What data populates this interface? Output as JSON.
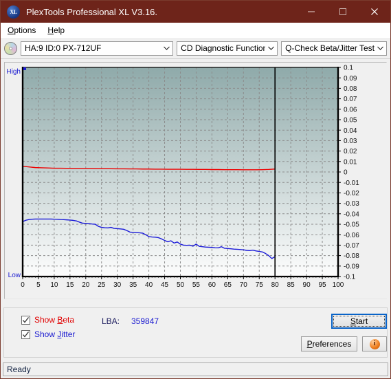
{
  "window": {
    "title": "PlexTools Professional XL V3.16.",
    "logo_text": "XL",
    "logo_icon": "xl-disc-logo",
    "minimize_icon": "minimize-icon",
    "maximize_icon": "maximize-icon",
    "close_icon": "close-icon"
  },
  "menu": {
    "items": [
      {
        "label": "Options",
        "accel": "O"
      },
      {
        "label": "Help",
        "accel": "H"
      }
    ]
  },
  "toolbar": {
    "disc_icon": "cd-disc-icon",
    "drive_combo": {
      "value": "HA:9 ID:0  PX-712UF",
      "arrow_icon": "chevron-down-icon"
    },
    "function_combo": {
      "value": "CD Diagnostic Functions",
      "arrow_icon": "chevron-down-icon"
    },
    "test_combo": {
      "value": "Q-Check Beta/Jitter Test",
      "arrow_icon": "chevron-down-icon"
    }
  },
  "controls": {
    "show_beta": {
      "label_pre": "Show ",
      "accel": "B",
      "label_post": "eta",
      "checked": true,
      "color": "#e00000"
    },
    "show_jitter": {
      "label_pre": "Show ",
      "accel": "J",
      "label_post": "itter",
      "checked": true,
      "color": "#1a1ad0"
    },
    "lba_label": "LBA:",
    "lba_value": "359847",
    "start_button": {
      "label_pre": "",
      "accel": "S",
      "label_post": "tart",
      "focused": true
    },
    "preferences_button": {
      "label_pre": "",
      "accel": "P",
      "label_post": "references"
    },
    "info_button": {
      "glyph": "i",
      "icon": "info-icon"
    }
  },
  "statusbar": {
    "text": "Ready"
  },
  "chart_data": {
    "type": "line",
    "title": "",
    "xlabel": "",
    "ylabel": "",
    "xlim": [
      0,
      100
    ],
    "ylim": [
      -0.1,
      0.1
    ],
    "xticks": [
      0,
      5,
      10,
      15,
      20,
      25,
      30,
      35,
      40,
      45,
      50,
      55,
      60,
      65,
      70,
      75,
      80,
      85,
      90,
      95,
      100
    ],
    "yticks": [
      0.1,
      0.09,
      0.08,
      0.07,
      0.06,
      0.05,
      0.04,
      0.03,
      0.02,
      0.01,
      0,
      -0.01,
      -0.02,
      -0.03,
      -0.04,
      -0.05,
      -0.06,
      -0.07,
      -0.08,
      -0.09,
      -0.1
    ],
    "ytick_labels": [
      "0.1",
      "0.09",
      "0.08",
      "0.07",
      "0.06",
      "0.05",
      "0.04",
      "0.03",
      "0.02",
      "0.01",
      "0",
      "-0.01",
      "-0.02",
      "-0.03",
      "-0.04",
      "-0.05",
      "-0.06",
      "-0.07",
      "-0.08",
      "-0.09",
      "-0.1"
    ],
    "grid": true,
    "grid_style": "dashed",
    "grid_color": "#8c8c8c",
    "axis_label_high": "High",
    "axis_label_low": "Low",
    "axis_label_color": "#1a1ad0",
    "data_end_marker_x": 80,
    "plot_bg_gradient": [
      "#8faaaa",
      "#fdfdfd"
    ],
    "legend_position": "none",
    "series": [
      {
        "name": "Beta",
        "color": "#ee0000",
        "x": [
          0,
          2,
          4,
          6,
          8,
          10,
          12,
          14,
          16,
          18,
          20,
          22,
          24,
          26,
          28,
          30,
          32,
          34,
          36,
          38,
          40,
          42,
          44,
          46,
          48,
          50,
          52,
          54,
          56,
          58,
          60,
          62,
          64,
          66,
          68,
          70,
          72,
          74,
          76,
          78,
          80
        ],
        "values": [
          0.0055,
          0.0048,
          0.0042,
          0.004,
          0.0038,
          0.0036,
          0.0036,
          0.0035,
          0.0034,
          0.0034,
          0.0033,
          0.0033,
          0.0032,
          0.0032,
          0.0031,
          0.003,
          0.003,
          0.0029,
          0.0029,
          0.0028,
          0.0028,
          0.0027,
          0.0027,
          0.0026,
          0.0026,
          0.0026,
          0.0025,
          0.0025,
          0.0024,
          0.0024,
          0.0023,
          0.0023,
          0.0022,
          0.0022,
          0.0022,
          0.0021,
          0.0021,
          0.0021,
          0.0022,
          0.0024,
          0.0028
        ]
      },
      {
        "name": "Jitter",
        "color": "#1a1ad8",
        "x": [
          0,
          1,
          2,
          3,
          4,
          5,
          6,
          7,
          8,
          9,
          10,
          11,
          12,
          13,
          14,
          15,
          16,
          17,
          18,
          19,
          20,
          21,
          22,
          23,
          24,
          25,
          26,
          27,
          28,
          29,
          30,
          31,
          32,
          33,
          34,
          35,
          36,
          37,
          38,
          39,
          40,
          41,
          42,
          43,
          44,
          45,
          46,
          47,
          48,
          49,
          50,
          51,
          52,
          53,
          54,
          55,
          56,
          57,
          58,
          59,
          60,
          61,
          62,
          63,
          64,
          65,
          66,
          67,
          68,
          69,
          70,
          71,
          72,
          73,
          74,
          75,
          76,
          77,
          78,
          79,
          80
        ],
        "values": [
          -0.0475,
          -0.0462,
          -0.0455,
          -0.0452,
          -0.045,
          -0.045,
          -0.045,
          -0.045,
          -0.045,
          -0.045,
          -0.0452,
          -0.0453,
          -0.0455,
          -0.0456,
          -0.0458,
          -0.046,
          -0.0463,
          -0.0468,
          -0.048,
          -0.049,
          -0.0492,
          -0.0494,
          -0.0498,
          -0.05,
          -0.052,
          -0.053,
          -0.0533,
          -0.0535,
          -0.053,
          -0.054,
          -0.0542,
          -0.0545,
          -0.0548,
          -0.056,
          -0.0575,
          -0.0578,
          -0.058,
          -0.0582,
          -0.0585,
          -0.06,
          -0.0618,
          -0.0622,
          -0.0624,
          -0.0628,
          -0.064,
          -0.0655,
          -0.0668,
          -0.0658,
          -0.068,
          -0.067,
          -0.069,
          -0.07,
          -0.0702,
          -0.07,
          -0.071,
          -0.069,
          -0.0712,
          -0.0715,
          -0.0718,
          -0.072,
          -0.0722,
          -0.0725,
          -0.0726,
          -0.0715,
          -0.073,
          -0.0732,
          -0.0735,
          -0.0738,
          -0.074,
          -0.0742,
          -0.0745,
          -0.075,
          -0.0752,
          -0.0748,
          -0.0755,
          -0.076,
          -0.0765,
          -0.078,
          -0.08,
          -0.0828,
          -0.081
        ]
      }
    ]
  }
}
